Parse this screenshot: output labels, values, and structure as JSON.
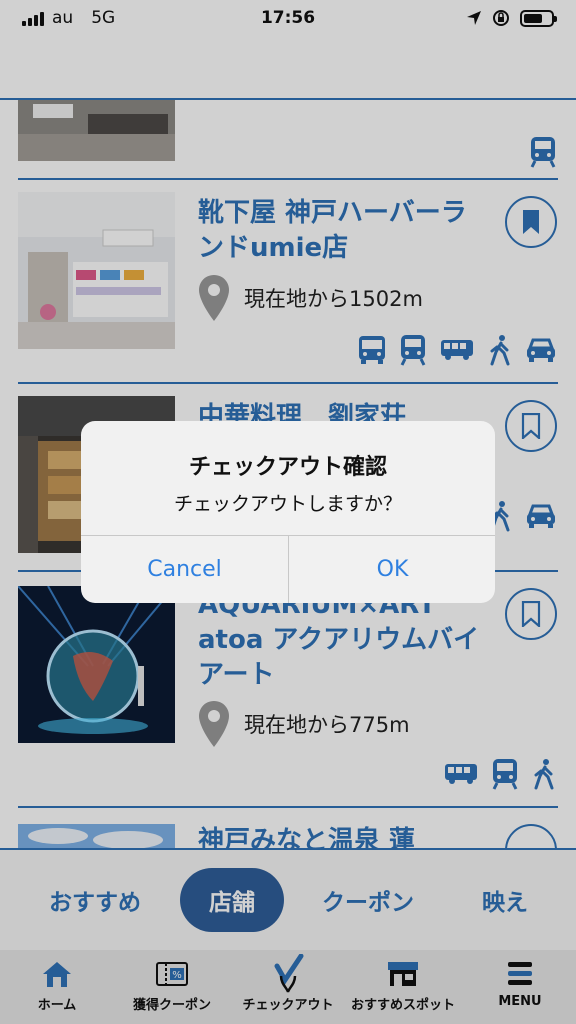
{
  "status_bar": {
    "carrier": "au",
    "network": "5G",
    "time": "17:56"
  },
  "list": {
    "items": [
      {
        "title": "",
        "distance": "",
        "bookmarked": false,
        "transport": [
          "train-icon"
        ]
      },
      {
        "title": "靴下屋 神戸ハーバーランドumie店",
        "distance": "現在地から1502m",
        "bookmarked": true,
        "transport": [
          "bus-icon",
          "train-icon",
          "coach-icon",
          "walk-icon",
          "car-icon"
        ]
      },
      {
        "title": "中華料理　劉家荘",
        "distance": "",
        "bookmarked": false,
        "transport": [
          "walk-icon",
          "car-icon"
        ]
      },
      {
        "title": "AQUARIUM×ART atoa アクアリウムバイアート",
        "distance": "現在地から775m",
        "bookmarked": false,
        "transport": [
          "coach-icon",
          "train-icon",
          "walk-icon"
        ]
      },
      {
        "title": "神戸みなと温泉 蓮",
        "distance": "",
        "bookmarked": false,
        "transport": []
      }
    ]
  },
  "dialog": {
    "title": "チェックアウト確認",
    "message": "チェックアウトしますか？",
    "cancel_label": "Cancel",
    "ok_label": "OK"
  },
  "segments": {
    "items": [
      {
        "label": "おすすめ",
        "active": false
      },
      {
        "label": "店舗",
        "active": true
      },
      {
        "label": "クーポン",
        "active": false
      },
      {
        "label": "映え",
        "active": false
      }
    ]
  },
  "tabbar": {
    "items": [
      {
        "label": "ホーム",
        "icon": "home-icon"
      },
      {
        "label": "獲得クーポン",
        "icon": "coupon-icon"
      },
      {
        "label": "チェックアウト",
        "icon": "checkout-icon"
      },
      {
        "label": "おすすめスポット",
        "icon": "shop-icon"
      },
      {
        "label": "MENU",
        "icon": "menu-icon"
      }
    ]
  },
  "colors": {
    "accent": "#2f72b8",
    "active_segment": "#2f5f9a",
    "dialog_button": "#2f80e0"
  }
}
